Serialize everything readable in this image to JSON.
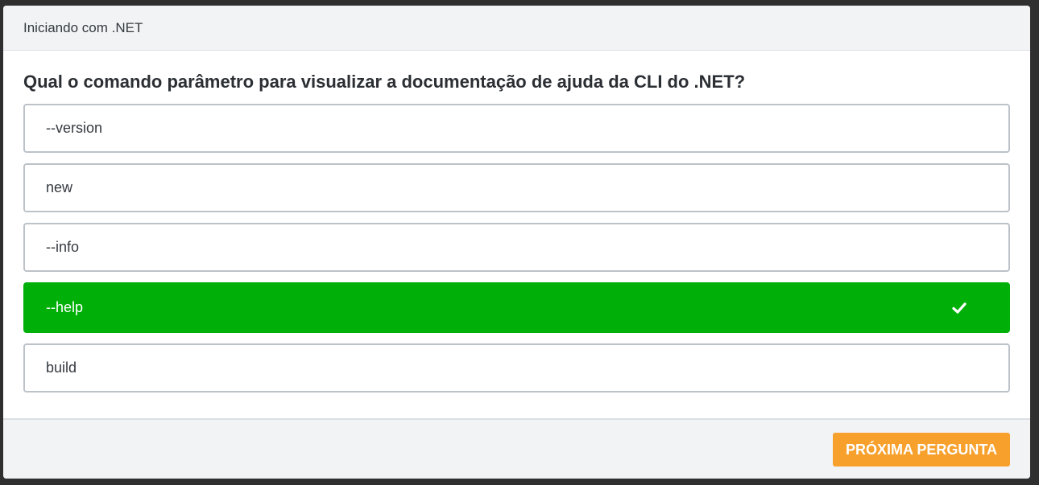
{
  "header": {
    "title": "Iniciando com .NET"
  },
  "quiz": {
    "question": "Qual o comando parâmetro para visualizar a documentação de ajuda da CLI do .NET?",
    "options": [
      {
        "label": "--version",
        "state": "default"
      },
      {
        "label": "new",
        "state": "default"
      },
      {
        "label": "--info",
        "state": "default"
      },
      {
        "label": "--help",
        "state": "correct",
        "icon": "check-icon"
      },
      {
        "label": "build",
        "state": "default"
      }
    ]
  },
  "footer": {
    "next_label": "PRÓXIMA PERGUNTA"
  },
  "colors": {
    "correct": "#00b009",
    "accent": "#f7a02b",
    "border": "#bcc2c8",
    "header_bg": "#f2f3f4"
  }
}
